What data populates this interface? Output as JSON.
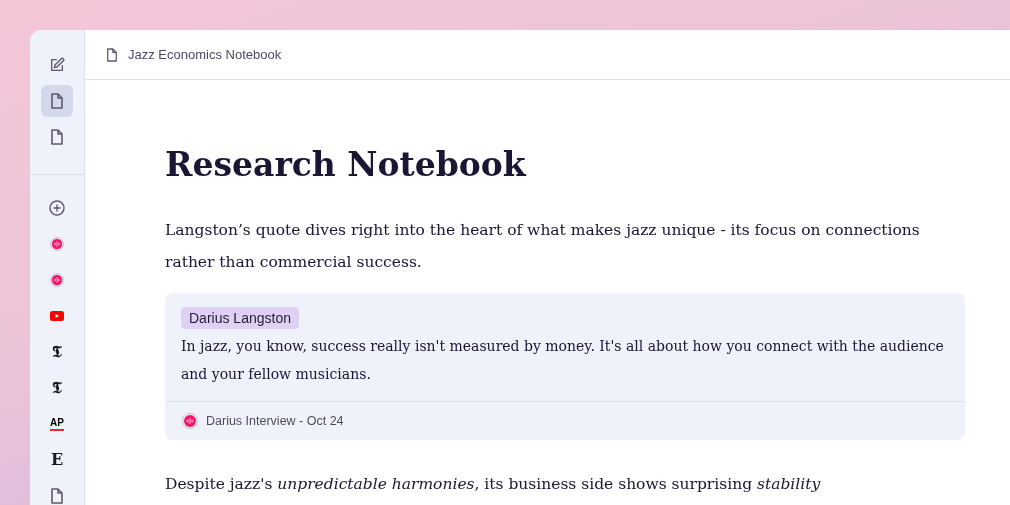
{
  "sidebar": {
    "items": [
      {
        "kind": "edit",
        "selected": false
      },
      {
        "kind": "doc",
        "selected": true
      },
      {
        "kind": "doc",
        "selected": false
      },
      {
        "kind": "divider"
      },
      {
        "kind": "add",
        "selected": false
      },
      {
        "kind": "audio",
        "selected": false
      },
      {
        "kind": "audio",
        "selected": false
      },
      {
        "kind": "video",
        "selected": false
      },
      {
        "kind": "logo",
        "glyph": "𝕿",
        "selected": false
      },
      {
        "kind": "logo",
        "glyph": "𝕿",
        "selected": false
      },
      {
        "kind": "ap",
        "glyph": "AP",
        "selected": false
      },
      {
        "kind": "logo",
        "glyph": "E",
        "selected": false
      },
      {
        "kind": "doc",
        "selected": false
      }
    ]
  },
  "header": {
    "title": "Jazz Economics Notebook"
  },
  "document": {
    "title": "Research Notebook",
    "blocks": [
      {
        "kind": "paragraph",
        "text": "Langston’s quote dives right into the heart of what makes jazz unique - its focus on connections rather than commercial success."
      },
      {
        "kind": "quote",
        "speaker": "Darius Langston",
        "text": "In jazz, you know, success really isn't measured by money. It's all about how you connect with the audience and your fellow musicians.",
        "source": "Darius Interview - Oct 24"
      },
      {
        "kind": "paragraph",
        "text": "Despite jazz's *unpredictable harmonies*, its business side shows surprising *stability*"
      }
    ]
  }
}
